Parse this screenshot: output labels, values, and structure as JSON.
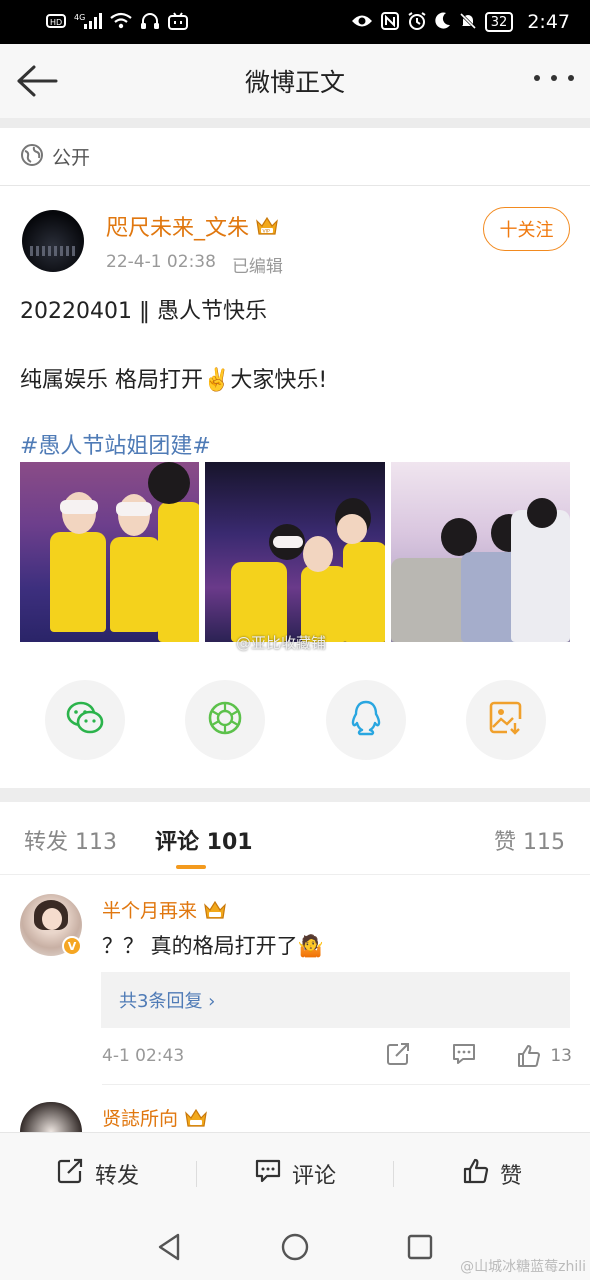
{
  "status_bar": {
    "left_icons": [
      "hd-icon",
      "signal-4g-icon",
      "wifi-icon",
      "headphones-icon",
      "bilibili-icon"
    ],
    "network_label": "4G",
    "right_icons": [
      "eye-icon",
      "nfc-icon",
      "alarm-icon",
      "moon-icon",
      "mute-icon"
    ],
    "battery": "32",
    "time": "2:47"
  },
  "nav": {
    "title": "微博正文",
    "back_icon": "back-arrow-icon",
    "more_icon": "more-icon"
  },
  "visibility": {
    "icon": "globe-icon",
    "label": "公开"
  },
  "post": {
    "author": "咫尺未来_文朱",
    "date": "22-4-1 02:38",
    "edited": "已编辑",
    "follow_label": "十关注",
    "line1": "20220401 ‖ 愚人节快乐",
    "line2": "纯属娱乐 格局打开✌️大家快乐!",
    "hashtag": "#愚人节站姐团建#",
    "image_watermark": "@亚比收藏铺"
  },
  "share": {
    "items": [
      {
        "name": "wechat",
        "icon": "wechat-icon",
        "color": "#2bb34b"
      },
      {
        "name": "moments",
        "icon": "moments-icon",
        "color": "#5cc14b"
      },
      {
        "name": "qq",
        "icon": "qq-icon",
        "color": "#29a6e0"
      },
      {
        "name": "save-image",
        "icon": "save-image-icon",
        "color": "#f0a02c"
      }
    ]
  },
  "tabs": {
    "repost": "转发 113",
    "comments": "评论 101",
    "likes": "赞 115"
  },
  "comments": [
    {
      "name": "半个月再来",
      "text": "？？ 真的格局打开了🤷",
      "replies": "共3条回复 ›",
      "time": "4-1 02:43",
      "likes": "13"
    },
    {
      "name": "贤誌所向"
    }
  ],
  "bottom_bar": {
    "repost": "转发",
    "comment": "评论",
    "like": "赞"
  },
  "sys_watermark": "@山城冰糖蓝莓zhili",
  "colors": {
    "brand_orange": "#e0770f",
    "link_blue": "#4f7bb6",
    "tab_indicator": "#f39a1e"
  }
}
